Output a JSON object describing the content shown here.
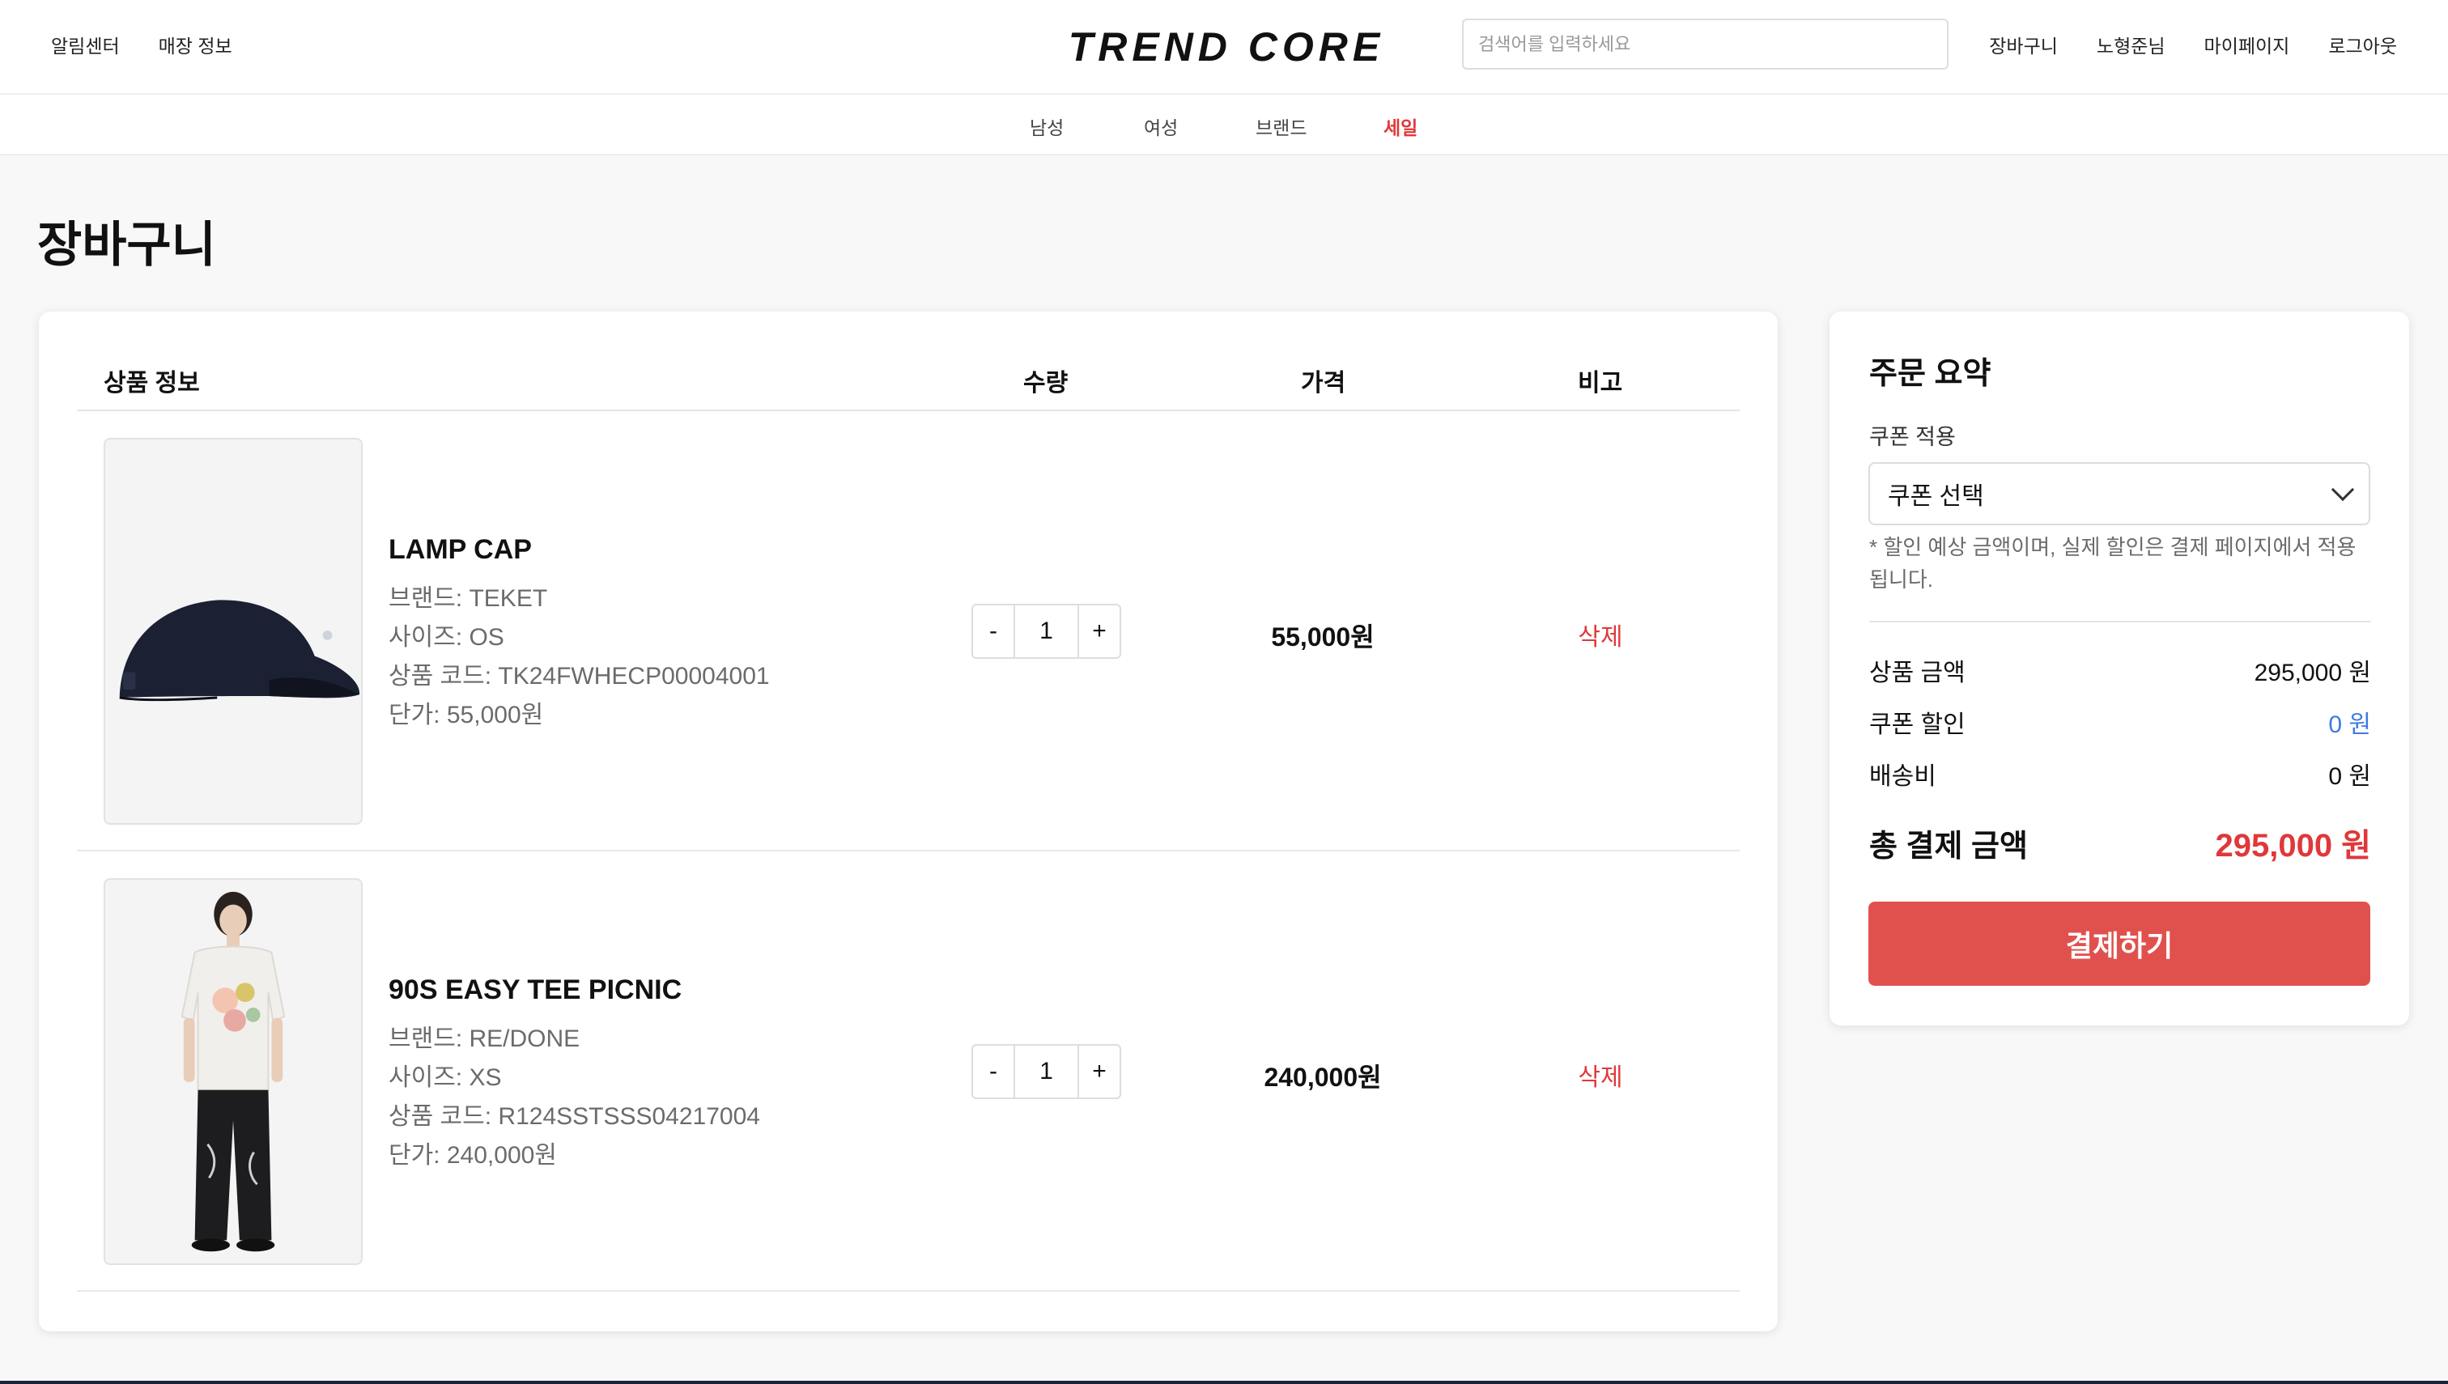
{
  "header": {
    "left_links": [
      "알림센터",
      "매장 정보"
    ],
    "logo_text": "TREND CORE",
    "search_placeholder": "검색어를 입력하세요",
    "right_links": [
      "장바구니",
      "노형준님",
      "마이페이지",
      "로그아웃"
    ]
  },
  "nav": {
    "items": [
      "남성",
      "여성",
      "브랜드",
      "세일"
    ]
  },
  "page": {
    "title": "장바구니"
  },
  "cart": {
    "headers": [
      "상품 정보",
      "수량",
      "가격",
      "비고"
    ],
    "items": [
      {
        "name": "LAMP CAP",
        "brand": "브랜드: TEKET",
        "size": "사이즈: OS",
        "code": "상품 코드: TK24FWHECP00004001",
        "unit_price": "단가: 55,000원",
        "qty": "1",
        "price": "55,000원",
        "delete_label": "삭제",
        "minus": "-",
        "plus": "+"
      },
      {
        "name": "90S EASY TEE PICNIC",
        "brand": "브랜드: RE/DONE",
        "size": "사이즈: XS",
        "code": "상품 코드: R124SSTSSS04217004",
        "unit_price": "단가: 240,000원",
        "qty": "1",
        "price": "240,000원",
        "delete_label": "삭제",
        "minus": "-",
        "plus": "+"
      }
    ]
  },
  "summary": {
    "title": "주문 요약",
    "coupon_label": "쿠폰 적용",
    "coupon_selected": "쿠폰 선택",
    "note": "* 할인 예상 금액이며, 실제 할인은 결제 페이지에서 적용됩니다.",
    "rows": [
      {
        "label": "상품 금액",
        "value": "295,000 원"
      },
      {
        "label": "쿠폰 할인",
        "value": "0 원"
      },
      {
        "label": "배송비",
        "value": "0 원"
      }
    ],
    "total_label": "총 결제 금액",
    "total_value": "295,000 원",
    "pay_button": "결제하기"
  },
  "colors": {
    "accent_red": "#e0383a",
    "pay_button": "#e0514e",
    "discount_blue": "#3f7be0"
  }
}
